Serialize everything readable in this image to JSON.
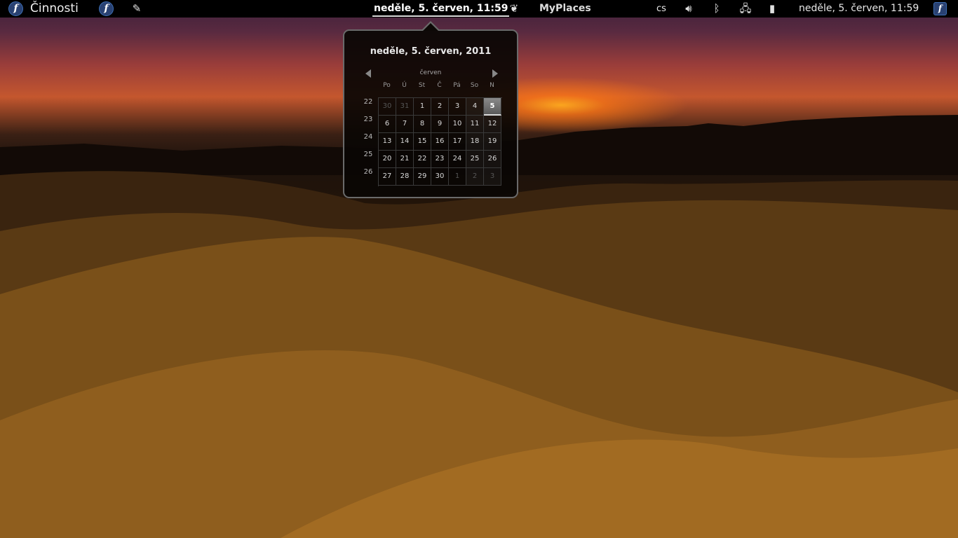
{
  "panel": {
    "activities_label": "Činnosti",
    "fedora_logo": "f",
    "app_icon": "fedora-icon",
    "launcher_icon": "pen-icon",
    "clock": "neděle,  5. červen, 11:59",
    "gnome_icon": "gnome-foot-icon",
    "myplaces_label": "MyPlaces",
    "keyboard_layout": "cs",
    "volume_icon": "volume-icon",
    "bluetooth_icon": "bluetooth-icon",
    "network_icon": "network-icon",
    "battery_icon": "battery-icon",
    "clock2": "neděle,  5. červen, 11:59",
    "user_logo": "f"
  },
  "calendar": {
    "header_date": "neděle,  5. červen, 2011",
    "month": "červen",
    "weekdays": [
      "Po",
      "Ú",
      "St",
      "Č",
      "Pá",
      "So",
      "N"
    ],
    "week_numbers": [
      "22",
      "23",
      "24",
      "25",
      "26"
    ],
    "weeks": [
      [
        "30",
        "31",
        "1",
        "2",
        "3",
        "4",
        "5"
      ],
      [
        "6",
        "7",
        "8",
        "9",
        "10",
        "11",
        "12"
      ],
      [
        "13",
        "14",
        "15",
        "16",
        "17",
        "18",
        "19"
      ],
      [
        "20",
        "21",
        "22",
        "23",
        "24",
        "25",
        "26"
      ],
      [
        "27",
        "28",
        "29",
        "30",
        "1",
        "2",
        "3"
      ]
    ],
    "today": "5"
  },
  "colors": {
    "panel_bg": "#000000",
    "popup_border": "#6a6a6a",
    "sunset": "#ffaa1e",
    "sand": "#a06a22"
  }
}
